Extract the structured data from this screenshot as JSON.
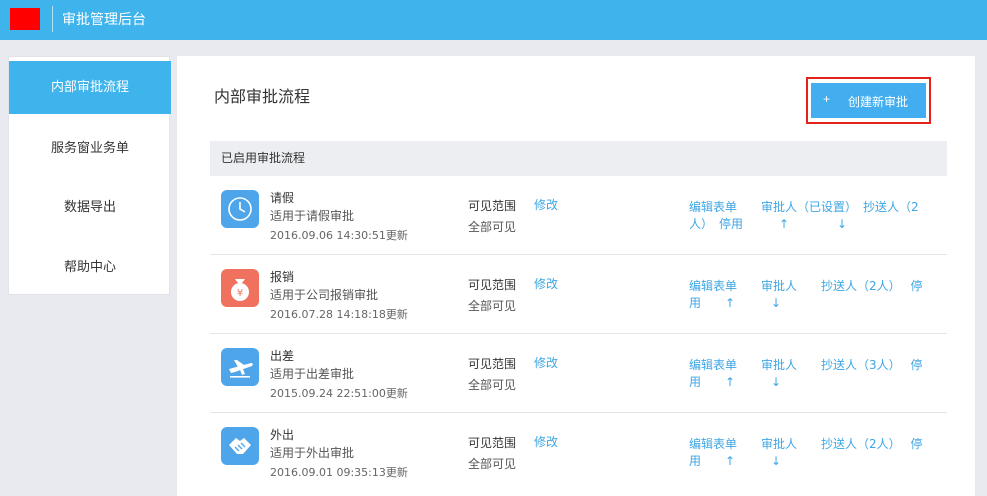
{
  "header": {
    "title": "审批管理后台"
  },
  "sidebar": {
    "items": [
      {
        "label": "内部审批流程"
      },
      {
        "label": "服务窗业务单"
      },
      {
        "label": "数据导出"
      },
      {
        "label": "帮助中心"
      }
    ]
  },
  "main": {
    "title": "内部审批流程",
    "create_plus": "+",
    "create_label": "创建新审批",
    "section_title": "已启用审批流程"
  },
  "rows": [
    {
      "icon": "clock-icon",
      "icon_color": "#4fa5e9",
      "name": "请假",
      "desc": "适用于请假审批",
      "time": "2016.09.06 14:30:51更新",
      "scope_label": "可见范围",
      "scope_value": "全部可见",
      "edit": "修改",
      "ops_line1": "编辑表单　　审批人（已设置）　抄送人（2",
      "ops_line2": "人）　停用　　　↑　　　　↓"
    },
    {
      "icon": "money-bag-icon",
      "icon_color": "#f0725e",
      "name": "报销",
      "desc": "适用于公司报销审批",
      "time": "2016.07.28 14:18:18更新",
      "scope_label": "可见范围",
      "scope_value": "全部可见",
      "edit": "修改",
      "ops_line1": "编辑表单　　审批人　　抄送人（2人）　 停",
      "ops_line2": "用　　↑　　　↓"
    },
    {
      "icon": "airplane-icon",
      "icon_color": "#4fa5e9",
      "name": "出差",
      "desc": "适用于出差审批",
      "time": "2015.09.24 22:51:00更新",
      "scope_label": "可见范围",
      "scope_value": "全部可见",
      "edit": "修改",
      "ops_line1": "编辑表单　　审批人　　抄送人（3人）　 停",
      "ops_line2": "用　　↑　　　↓"
    },
    {
      "icon": "handshake-icon",
      "icon_color": "#4fa5e9",
      "name": "外出",
      "desc": "适用于外出审批",
      "time": "2016.09.01 09:35:13更新",
      "scope_label": "可见范围",
      "scope_value": "全部可见",
      "edit": "修改",
      "ops_line1": "编辑表单　　审批人　　抄送人（2人）　 停",
      "ops_line2": "用　　↑　　　↓"
    }
  ]
}
